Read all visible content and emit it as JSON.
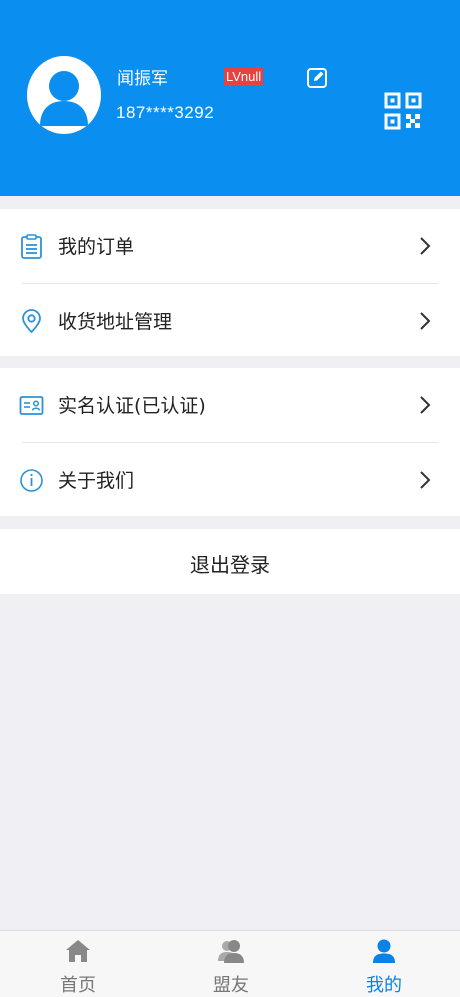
{
  "profile": {
    "name": "闻振军",
    "level_badge": "LVnull",
    "phone": "187****3292"
  },
  "menu_group_1": [
    {
      "label": "我的订单",
      "icon": "order-list-icon"
    },
    {
      "label": "收货地址管理",
      "icon": "location-pin-icon"
    }
  ],
  "menu_group_2": [
    {
      "label": "实名认证(已认证)",
      "icon": "id-card-icon"
    },
    {
      "label": "关于我们",
      "icon": "info-icon"
    }
  ],
  "logout": {
    "label": "退出登录"
  },
  "tabs": [
    {
      "label": "首页",
      "icon": "home-icon",
      "active": false
    },
    {
      "label": "盟友",
      "icon": "allies-icon",
      "active": false
    },
    {
      "label": "我的",
      "icon": "user-icon",
      "active": true
    }
  ],
  "colors": {
    "header_bg": "#0a8ff0",
    "accent": "#0a82e6",
    "badge_bg": "#e8423f",
    "page_bg": "#efeff4"
  }
}
